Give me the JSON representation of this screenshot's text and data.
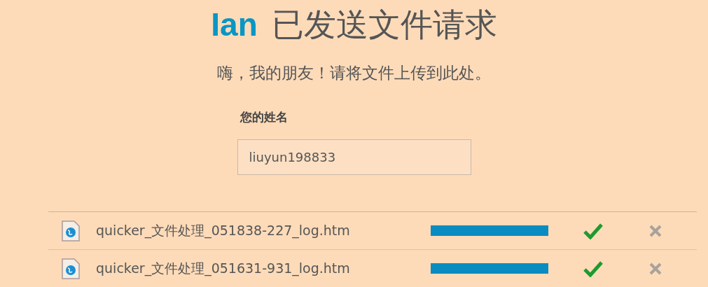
{
  "title": {
    "sender": "Ian",
    "text": "已发送文件请求"
  },
  "subtitle": "嗨，我的朋友！请将文件上传到此处。",
  "name_field": {
    "label": "您的姓名",
    "value": "liuyun198833"
  },
  "files": [
    {
      "name": "quicker_文件处理_051838-227_log.htm",
      "level": 1,
      "kind": "done"
    },
    {
      "name": "quicker_文件处理_051631-931_log.htm",
      "level": 1,
      "kind": "done"
    }
  ]
}
